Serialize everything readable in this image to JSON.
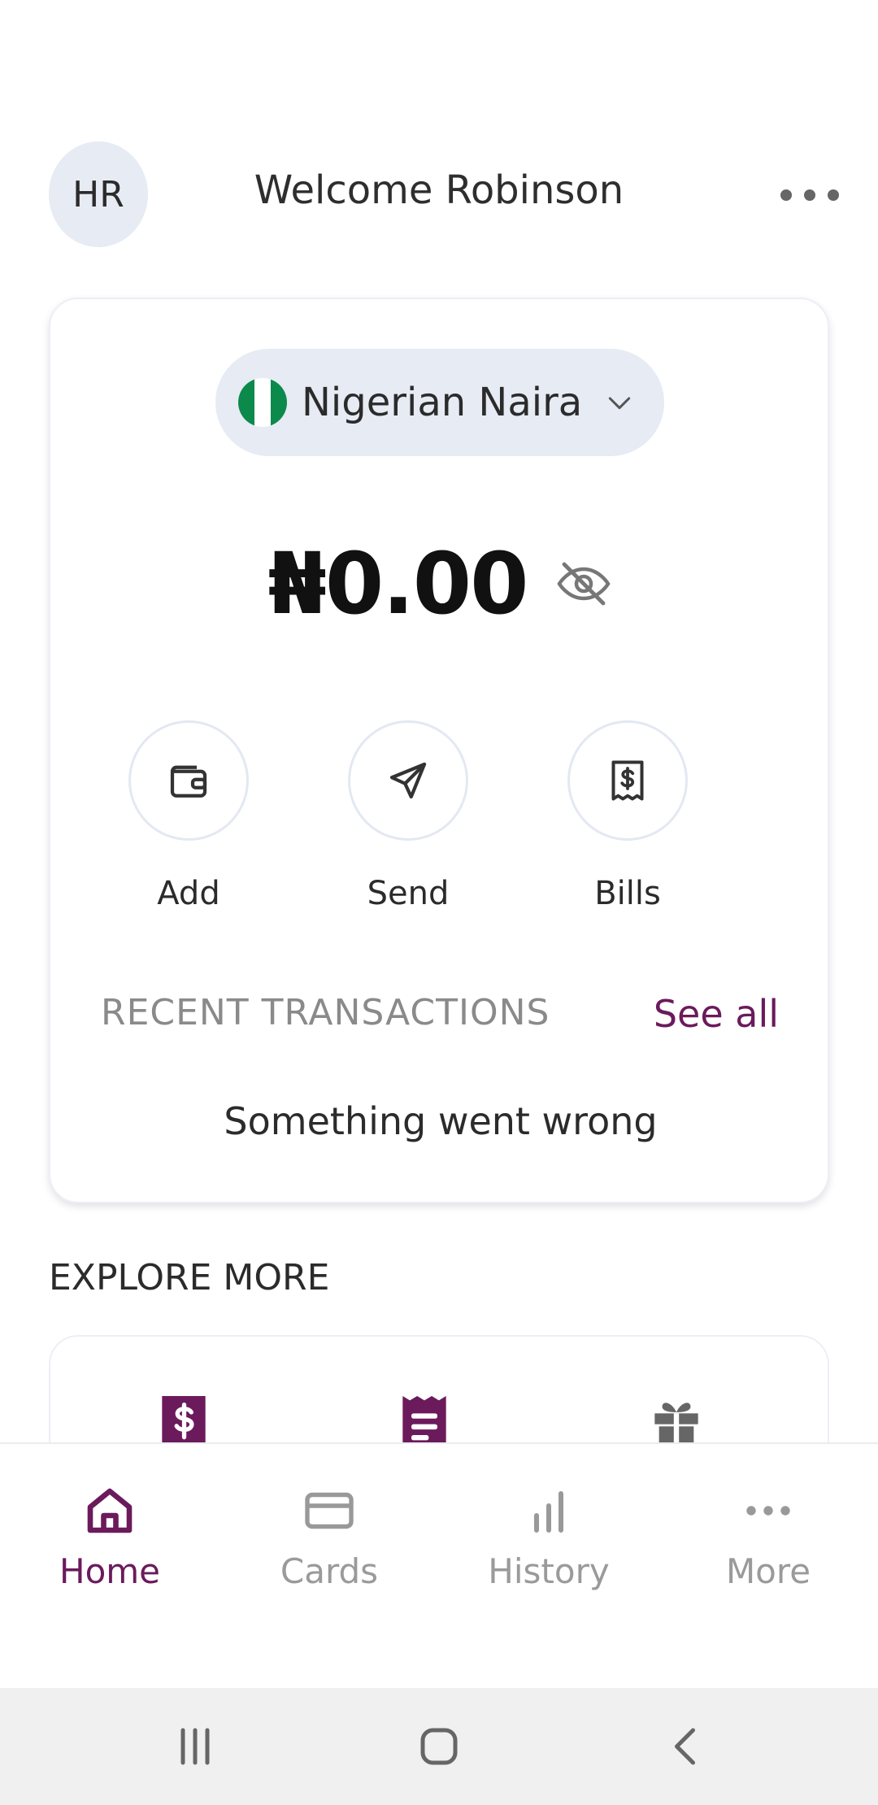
{
  "header": {
    "avatar_initials": "HR",
    "welcome_text": "Welcome Robinson"
  },
  "wallet": {
    "currency_label": "Nigerian Naira",
    "balance": "₦0.00",
    "actions": [
      {
        "label": "Add",
        "icon": "wallet-icon"
      },
      {
        "label": "Send",
        "icon": "send-icon"
      },
      {
        "label": "Bills",
        "icon": "receipt-dollar-icon"
      }
    ],
    "recent_title": "RECENT TRANSACTIONS",
    "see_all": "See all",
    "error_message": "Something went wrong"
  },
  "explore": {
    "title": "EXPLORE MORE",
    "icons": [
      "dollar-receipt-icon",
      "document-icon",
      "gift-icon"
    ]
  },
  "bottom_nav": {
    "items": [
      {
        "label": "Home",
        "icon": "home-icon",
        "active": true
      },
      {
        "label": "Cards",
        "icon": "card-icon",
        "active": false
      },
      {
        "label": "History",
        "icon": "bar-chart-icon",
        "active": false
      },
      {
        "label": "More",
        "icon": "more-dots-icon",
        "active": false
      }
    ]
  },
  "colors": {
    "accent": "#6b1a5c",
    "pill_bg": "#e6ebf4",
    "flag_green": "#0b8a4c"
  }
}
